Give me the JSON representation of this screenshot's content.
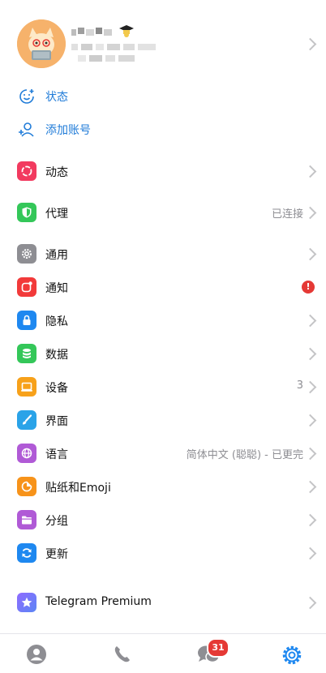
{
  "quick_links": {
    "status": "状态",
    "add_account": "添加账号"
  },
  "menu": {
    "moments": {
      "label": "动态",
      "color": "#f23a5f"
    },
    "proxy": {
      "label": "代理",
      "value": "已连接",
      "color": "#34c759"
    },
    "general": {
      "label": "通用",
      "color": "#8e8e93"
    },
    "notifications": {
      "label": "通知",
      "alert": "!",
      "color": "#f23a3a"
    },
    "privacy": {
      "label": "隐私",
      "color": "#1e88f0"
    },
    "data": {
      "label": "数据",
      "color": "#34c759"
    },
    "devices": {
      "label": "设备",
      "value": "3",
      "color": "#f7a11a"
    },
    "appearance": {
      "label": "界面",
      "color": "#2aa3e8"
    },
    "language": {
      "label": "语言",
      "value": "简体中文 (聪聪) - 已更完",
      "color": "#b05ad6"
    },
    "stickers": {
      "label": "贴纸和Emoji",
      "color": "#f7931a"
    },
    "folders": {
      "label": "分组",
      "color": "#b05ad6"
    },
    "updates": {
      "label": "更新",
      "color": "#1e88f0"
    },
    "premium": {
      "label": "Telegram Premium",
      "color": "#7b61ff"
    }
  },
  "tabbar": {
    "chats_badge": "31",
    "accent": "#1e88f0"
  }
}
